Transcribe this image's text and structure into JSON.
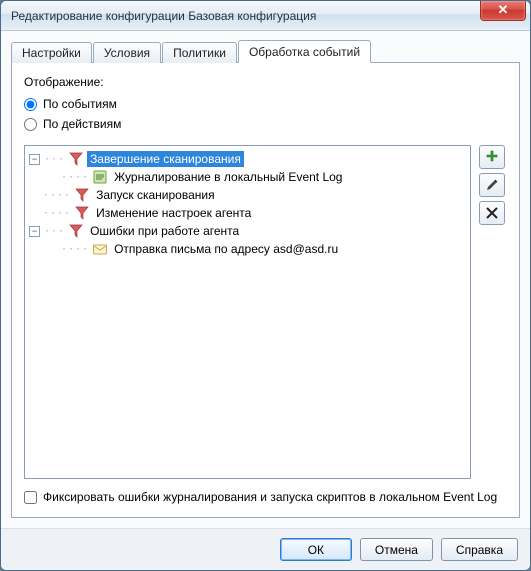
{
  "window": {
    "title": "Редактирование конфигурации Базовая конфигурация",
    "close_glyph": "✕"
  },
  "tabs": {
    "settings": "Настройки",
    "conditions": "Условия",
    "policies": "Политики",
    "events": "Обработка событий"
  },
  "display": {
    "label": "Отображение:",
    "by_events": "По событиям",
    "by_actions": "По действиям"
  },
  "tree": {
    "scan_complete": "Завершение сканирования",
    "journal_local": "Журналирование в локальный Event Log",
    "scan_start": "Запуск сканирования",
    "settings_change": "Изменение настроек агента",
    "agent_errors": "Ошибки при работе агента",
    "send_mail": "Отправка письма по адресу asd@asd.ru"
  },
  "checkbox": {
    "log_errors": "Фиксировать ошибки журналирования и запуска скриптов в локальном Event Log"
  },
  "buttons": {
    "ok": "ОК",
    "cancel": "Отмена",
    "help": "Справка"
  },
  "icons": {
    "add": "add-icon",
    "edit": "edit-icon",
    "delete": "delete-icon"
  }
}
